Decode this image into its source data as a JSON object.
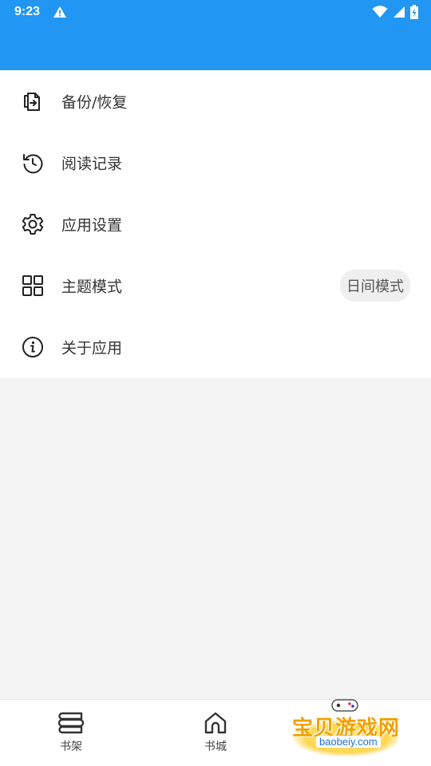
{
  "status_bar": {
    "time": "9:23"
  },
  "menu": {
    "items": [
      {
        "label": "备份/恢复",
        "icon": "backup-restore-icon"
      },
      {
        "label": "阅读记录",
        "icon": "history-icon"
      },
      {
        "label": "应用设置",
        "icon": "gear-icon"
      },
      {
        "label": "主题模式",
        "icon": "grid-icon",
        "value": "日间模式"
      },
      {
        "label": "关于应用",
        "icon": "info-icon"
      }
    ]
  },
  "bottom_nav": {
    "items": [
      {
        "label": "书架",
        "icon": "bookshelf-icon"
      },
      {
        "label": "书城",
        "icon": "home-icon"
      }
    ]
  },
  "watermark": {
    "title": "宝贝游戏网",
    "url": "baobeiy.com"
  },
  "colors": {
    "app_bar": "#2196f3",
    "background": "#f4f4f4",
    "surface": "#ffffff"
  }
}
